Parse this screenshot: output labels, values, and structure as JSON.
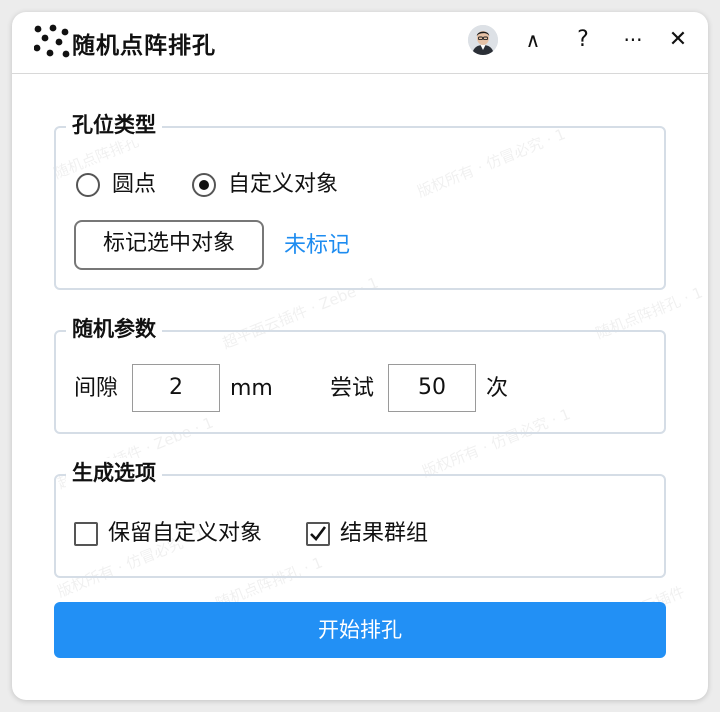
{
  "titlebar": {
    "title": "随机点阵排孔",
    "logo_icon": "random-dots-logo",
    "collapse_label": "∧",
    "help_label": "?",
    "more_label": "···",
    "close_label": "✕"
  },
  "watermarks": [
    "随机点阵排孔 · 1",
    "版权所有 · 仿冒必究 · 1",
    "超平面云插件 · Zebe · 1",
    "随机点阵排孔 · 1",
    "版权所有 · 仿冒必究 · 1",
    "超平面云插件 · Zebe · 1",
    "随机点阵排孔 · 1",
    "版权所有 · 仿冒必究 · 1",
    "超平面云插件"
  ],
  "hole_type": {
    "legend": "孔位类型",
    "options": [
      {
        "label": "圆点",
        "checked": false
      },
      {
        "label": "自定义对象",
        "checked": true
      }
    ],
    "mark_button": "标记选中对象",
    "mark_status": "未标记"
  },
  "random_params": {
    "legend": "随机参数",
    "gap_label": "间隙",
    "gap_value": "2",
    "gap_unit": "mm",
    "tries_label": "尝试",
    "tries_value": "50",
    "tries_unit": "次"
  },
  "gen_options": {
    "legend": "生成选项",
    "keep_custom": {
      "label": "保留自定义对象",
      "checked": false
    },
    "group_result": {
      "label": "结果群组",
      "checked": true
    }
  },
  "actions": {
    "start": "开始排孔"
  },
  "colors": {
    "accent": "#2290f5",
    "link": "#1e8cf0",
    "border": "#d5dde6"
  }
}
